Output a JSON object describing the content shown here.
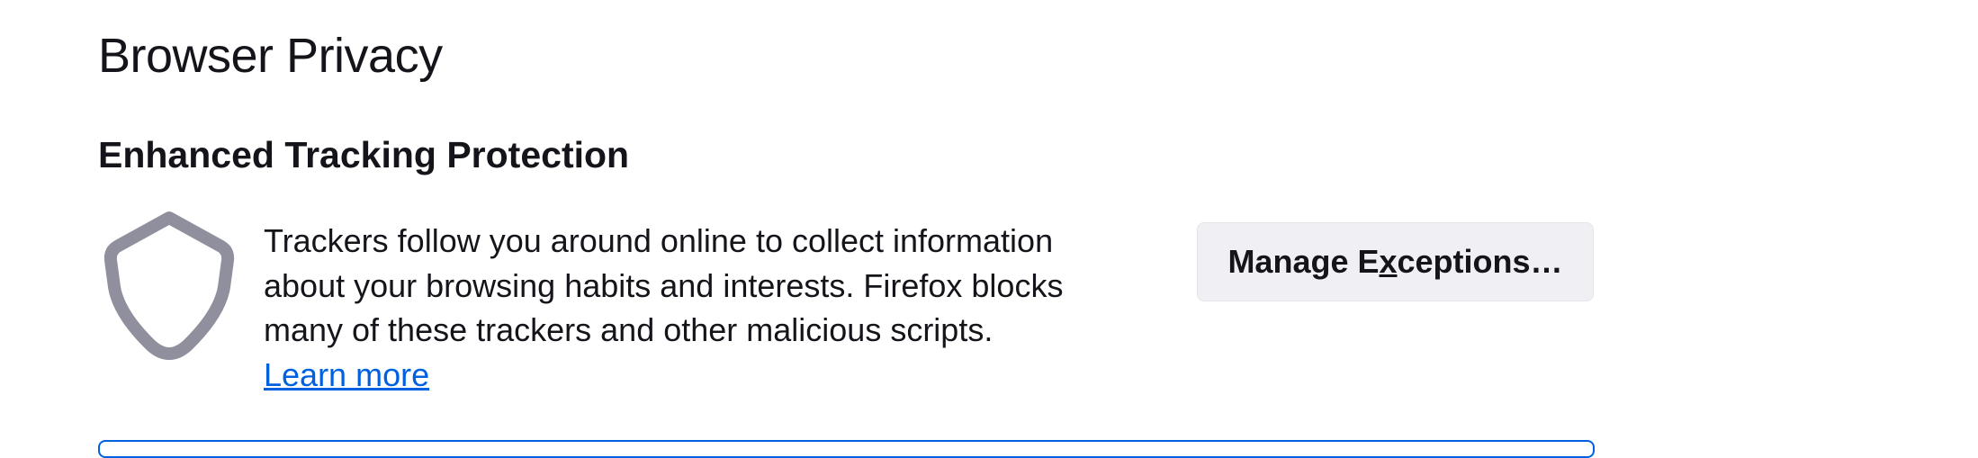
{
  "page": {
    "title": "Browser Privacy"
  },
  "tracking_protection": {
    "heading": "Enhanced Tracking Protection",
    "icon": "shield-icon",
    "description_lines": [
      "Trackers follow you around online to collect information",
      "about your browsing habits and interests. Firefox blocks",
      "many of these trackers and other malicious scripts."
    ],
    "learn_more_label": "Learn more",
    "manage_button": {
      "label_before": "Manage E",
      "accesskey": "x",
      "label_after": "ceptions…"
    }
  },
  "colors": {
    "link": "#0061e0",
    "button_bg": "#f0f0f4",
    "icon_stroke": "#8f8f9d",
    "text": "#15141a",
    "focus_border": "#0061e0"
  }
}
